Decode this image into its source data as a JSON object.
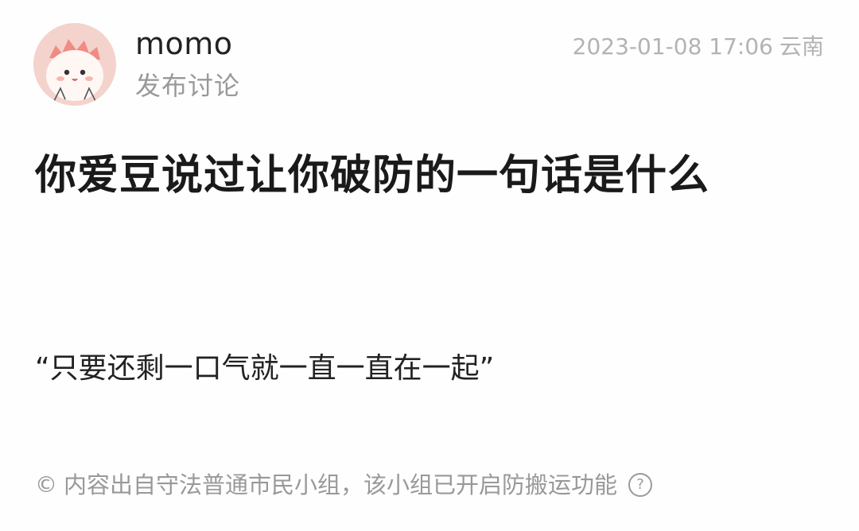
{
  "post": {
    "author": {
      "name": "momo",
      "action": "发布讨论",
      "avatar_icon": "cute-character-avatar"
    },
    "timestamp": "2023-01-08 17:06",
    "location": "云南",
    "title": "你爱豆说过让你破防的一句话是什么",
    "body": "“只要还剩一口气就一直一直在一起”"
  },
  "footer": {
    "copyright_icon": "©",
    "notice": "内容出自守法普通市民小组，该小组已开启防搬运功能",
    "help_icon": "?"
  },
  "colors": {
    "text_primary": "#222222",
    "text_secondary": "#999999",
    "meta": "#b3b3b3",
    "avatar_bg": "#f6d7d2"
  }
}
